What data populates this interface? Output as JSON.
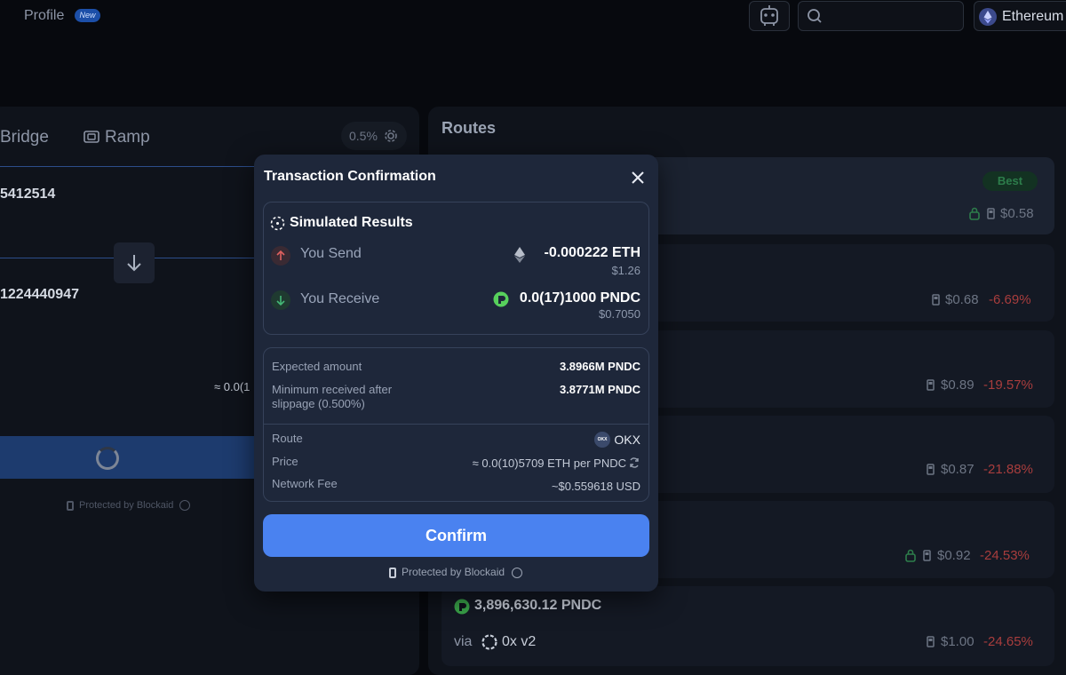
{
  "topbar": {
    "profile_label": "Profile",
    "new_badge": "New",
    "search_placeholder": "",
    "chain_label": "Ethereum"
  },
  "swap_panel": {
    "tabs": [
      "Bridge",
      "Ramp"
    ],
    "slippage": "0.5%",
    "send_amount": "5412514",
    "receive_amount": "1224440947",
    "rate_prefix": "≈ 0.0(1",
    "protected_label": "Protected by Blockaid"
  },
  "routes": {
    "title": "Routes",
    "best_badge": "Best",
    "items": [
      {
        "gas": "$0.58",
        "diff": ""
      },
      {
        "gas": "$0.68",
        "diff": "-6.69%"
      },
      {
        "gas": "$0.89",
        "diff": "-19.57%"
      },
      {
        "gas": "$0.87",
        "diff": "-21.88%"
      },
      {
        "gas": "$0.92",
        "diff": "-24.53%"
      },
      {
        "gas": "$1.00",
        "diff": "-24.65%",
        "amount": "3,896,630.12 PNDC",
        "via_prefix": "via",
        "via_name": "0x v2"
      }
    ]
  },
  "modal": {
    "title": "Transaction Confirmation",
    "simulated_title": "Simulated Results",
    "send_label": "You Send",
    "send_value": "-0.000222 ETH",
    "send_usd": "$1.26",
    "receive_label": "You Receive",
    "receive_value": "0.0(17)1000 PNDC",
    "receive_usd": "$0.7050",
    "expected_label": "Expected amount",
    "expected_value": "3.8966M PNDC",
    "min_label_1": "Minimum received after",
    "min_label_2": "slippage (0.500%)",
    "min_value": "3.8771M PNDC",
    "route_label": "Route",
    "route_value": "OKX",
    "route_icon_text": "OKX",
    "price_label": "Price",
    "price_value": "≈ 0.0(10)5709 ETH per PNDC",
    "fee_label": "Network Fee",
    "fee_value": "~$0.559618 USD",
    "confirm_label": "Confirm",
    "protected_label": "Protected by Blockaid"
  },
  "colors": {
    "accent": "#4a82f0",
    "negative": "#a83d3d",
    "positive": "#2d7d4b",
    "modal_bg": "#1e273a"
  }
}
